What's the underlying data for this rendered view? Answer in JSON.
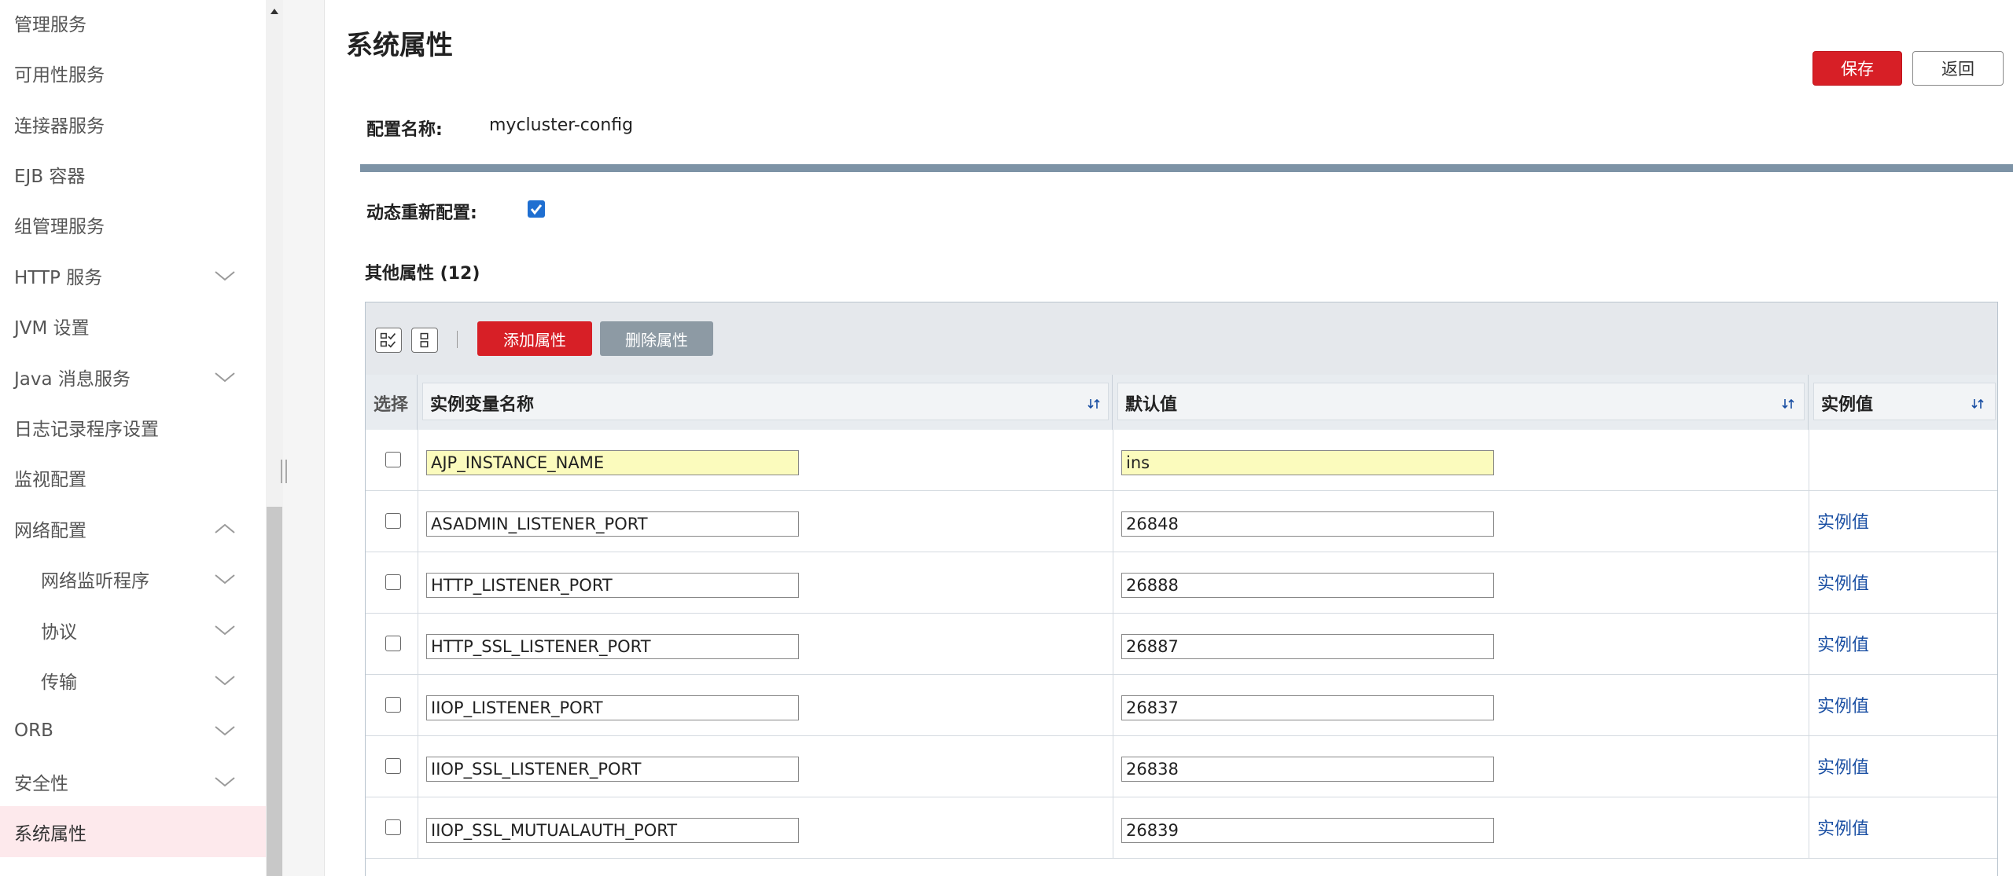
{
  "sidebar": {
    "items": [
      {
        "label": "管理服务",
        "chevron": ""
      },
      {
        "label": "可用性服务",
        "chevron": ""
      },
      {
        "label": "连接器服务",
        "chevron": ""
      },
      {
        "label": "EJB 容器",
        "chevron": ""
      },
      {
        "label": "组管理服务",
        "chevron": ""
      },
      {
        "label": "HTTP 服务",
        "chevron": "down"
      },
      {
        "label": "JVM 设置",
        "chevron": ""
      },
      {
        "label": "Java 消息服务",
        "chevron": "down"
      },
      {
        "label": "日志记录程序设置",
        "chevron": ""
      },
      {
        "label": "监视配置",
        "chevron": ""
      },
      {
        "label": "网络配置",
        "chevron": "up"
      },
      {
        "label": "网络监听程序",
        "chevron": "down",
        "sub": true
      },
      {
        "label": "协议",
        "chevron": "down",
        "sub": true
      },
      {
        "label": "传输",
        "chevron": "down",
        "sub": true
      },
      {
        "label": "ORB",
        "chevron": "down"
      },
      {
        "label": "安全性",
        "chevron": "down"
      },
      {
        "label": "系统属性",
        "chevron": "",
        "active": true
      }
    ]
  },
  "page": {
    "title": "系统属性",
    "save_label": "保存",
    "back_label": "返回",
    "config_name_label": "配置名称:",
    "config_name_value": "mycluster-config",
    "dynamic_reconfig_label": "动态重新配置:",
    "dynamic_reconfig_checked": true,
    "other_props_heading": "其他属性 (12)"
  },
  "toolbar": {
    "add_label": "添加属性",
    "delete_label": "删除属性"
  },
  "table": {
    "headers": {
      "select": "选择",
      "name": "实例变量名称",
      "default": "默认值",
      "instance": "实例值"
    },
    "rows": [
      {
        "name": "AJP_INSTANCE_NAME",
        "default": "ins",
        "instance_link": "",
        "highlight": true
      },
      {
        "name": "ASADMIN_LISTENER_PORT",
        "default": "26848",
        "instance_link": "实例值"
      },
      {
        "name": "HTTP_LISTENER_PORT",
        "default": "26888",
        "instance_link": "实例值"
      },
      {
        "name": "HTTP_SSL_LISTENER_PORT",
        "default": "26887",
        "instance_link": "实例值"
      },
      {
        "name": "IIOP_LISTENER_PORT",
        "default": "26837",
        "instance_link": "实例值"
      },
      {
        "name": "IIOP_SSL_LISTENER_PORT",
        "default": "26838",
        "instance_link": "实例值"
      },
      {
        "name": "IIOP_SSL_MUTUALAUTH_PORT",
        "default": "26839",
        "instance_link": "实例值"
      }
    ]
  },
  "colors": {
    "accent_red": "#d71f26",
    "link_blue": "#1a4fa3",
    "active_nav_bg": "#fde9ec",
    "highlight_input": "#fbfbbd"
  }
}
